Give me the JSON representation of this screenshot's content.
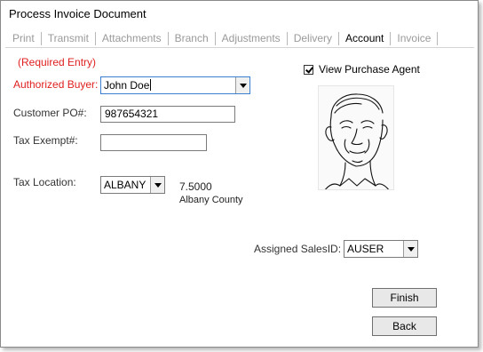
{
  "window": {
    "title": "Process Invoice Document"
  },
  "tabs": [
    {
      "label": "Print",
      "active": false
    },
    {
      "label": "Transmit",
      "active": false
    },
    {
      "label": "Attachments",
      "active": false
    },
    {
      "label": "Branch",
      "active": false
    },
    {
      "label": "Adjustments",
      "active": false
    },
    {
      "label": "Delivery",
      "active": false
    },
    {
      "label": "Account",
      "active": true
    },
    {
      "label": "Invoice",
      "active": false
    }
  ],
  "form": {
    "required_note": "(Required Entry)",
    "authorized_buyer": {
      "label": "Authorized Buyer:",
      "value": "John Doe"
    },
    "customer_po": {
      "label": "Customer PO#:",
      "value": "987654321"
    },
    "tax_exempt": {
      "label": "Tax Exempt#:",
      "value": ""
    },
    "tax_location": {
      "label": "Tax Location:",
      "value": "ALBANY",
      "rate": "7.5000",
      "county": "Albany County"
    },
    "view_purchase_agent": {
      "label": "View Purchase Agent",
      "checked": true
    },
    "assigned_sales_id": {
      "label": "Assigned SalesID:",
      "value": "AUSER"
    }
  },
  "buttons": {
    "finish": "Finish",
    "back": "Back"
  },
  "colors": {
    "required": "#e02020",
    "focus_border": "#3c7fd0"
  }
}
